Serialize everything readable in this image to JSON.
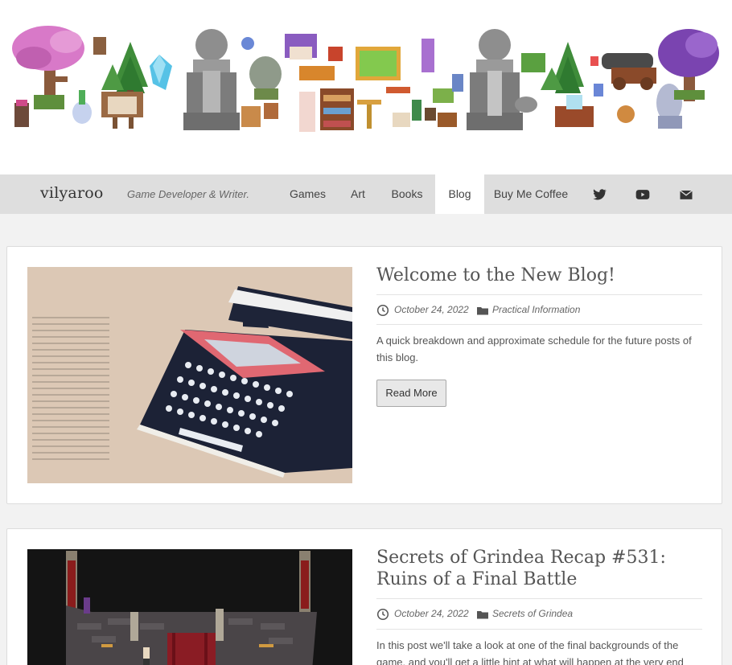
{
  "site": {
    "title": "vilyaroo",
    "tagline": "Game Developer & Writer."
  },
  "nav": {
    "items": [
      {
        "label": "Games"
      },
      {
        "label": "Art"
      },
      {
        "label": "Books"
      },
      {
        "label": "Blog"
      },
      {
        "label": "Buy Me Coffee"
      }
    ],
    "active": "Blog",
    "social_icons": [
      "twitter-icon",
      "youtube-icon",
      "mail-icon"
    ]
  },
  "colors": {
    "navbar": "#dedede",
    "active_tab": "#ffffff",
    "page_bg": "#f2f2f2"
  },
  "posts": [
    {
      "title": "Welcome to the New Blog!",
      "date": "October 24, 2022",
      "category": "Practical Information",
      "excerpt": "A quick breakdown and approximate schedule for the future posts of this blog.",
      "button": "Read More",
      "thumbnail": "typewriter illustration"
    },
    {
      "title": "Secrets of Grindea Recap #531: Ruins of a Final Battle",
      "date": "October 24, 2022",
      "category": "Secrets of Grindea",
      "excerpt": "In this post we'll take a look at one of the final backgrounds of the game, and you'll get a little hint at what will happen at the very end",
      "thumbnail": "pixel art ruins scene"
    }
  ]
}
